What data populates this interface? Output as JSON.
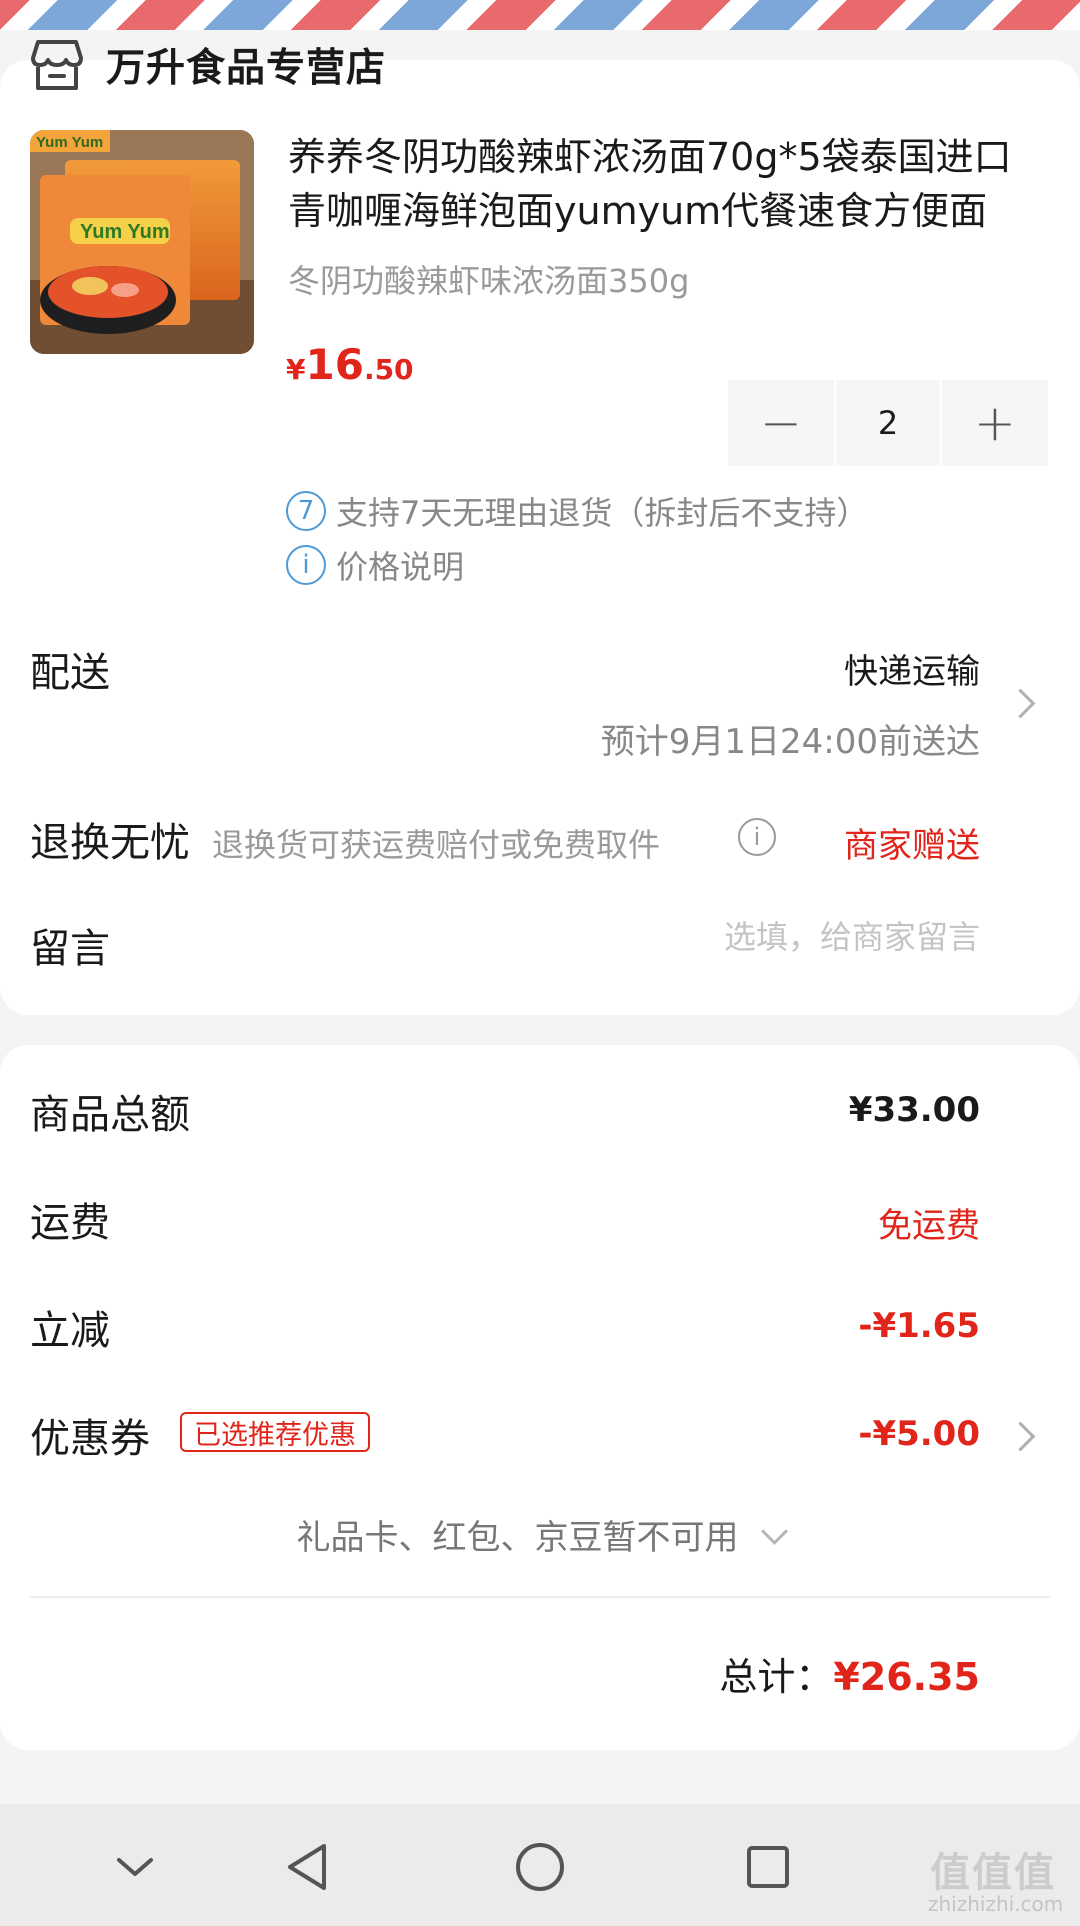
{
  "store": {
    "name": "万升食品专营店",
    "icon": "store-icon"
  },
  "product": {
    "title": "养养冬阴功酸辣虾浓汤面70g*5袋泰国进口青咖喱海鲜泡面yumyum代餐速食方便面",
    "spec": "冬阴功酸辣虾味浓汤面350g",
    "price": {
      "currency": "¥",
      "integer": "16",
      "decimal": ".50"
    },
    "quantity": "2",
    "minus_label": "−",
    "plus_label": "+",
    "image_brand": "Yum Yum",
    "services": [
      {
        "icon": "7",
        "text": "支持7天无理由退货（拆封后不支持）"
      },
      {
        "icon": "i",
        "text": "价格说明"
      }
    ]
  },
  "delivery": {
    "label": "配送",
    "method": "快递运输",
    "eta": "预计9月1日24:00前送达"
  },
  "return_service": {
    "label": "退换无忧",
    "desc": "退换货可获运费赔付或免费取件",
    "value": "商家赠送"
  },
  "note": {
    "label": "留言",
    "placeholder": "选填，给商家留言"
  },
  "summary": {
    "goods_total": {
      "label": "商品总额",
      "value": "¥33.00"
    },
    "shipping": {
      "label": "运费",
      "value": "免运费"
    },
    "discount": {
      "label": "立减",
      "value": "-¥1.65"
    },
    "coupon": {
      "label": "优惠券",
      "badge": "已选推荐优惠",
      "value": "-¥5.00"
    },
    "unavailable": "礼品卡、红包、京豆暂不可用",
    "total_label": "总计：",
    "total_value": "¥26.35"
  },
  "watermark": {
    "text": "值值值",
    "sub": "zhizhizhi.com"
  },
  "colors": {
    "accent_red": "#e1251b",
    "info_blue": "#4e9ad6"
  }
}
